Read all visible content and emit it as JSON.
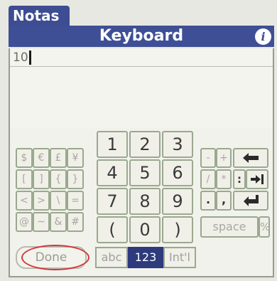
{
  "app": {
    "tab_label": "Notas",
    "title": "Keyboard",
    "info_icon": "i"
  },
  "editor": {
    "value": "10"
  },
  "keyboard": {
    "symbols": [
      [
        "$",
        "€",
        "£",
        "¥"
      ],
      [
        "[",
        "]",
        "{",
        "}"
      ],
      [
        "<",
        ">",
        "\\",
        "="
      ],
      [
        "@",
        "~",
        "&",
        "#"
      ]
    ],
    "numbers": [
      [
        "1",
        "2",
        "3"
      ],
      [
        "4",
        "5",
        "6"
      ],
      [
        "7",
        "8",
        "9"
      ],
      [
        "(",
        "0",
        ")"
      ]
    ],
    "right_keys": {
      "minus": "-",
      "plus": "+",
      "slash": "/",
      "asterisk": "*",
      "colon": ":",
      "period": ".",
      "comma": ",",
      "space": "space",
      "percent": "%",
      "backspace_icon": "backspace-arrow-icon",
      "tab_icon": "tab-arrow-icon",
      "enter_icon": "enter-arrow-icon"
    },
    "done": "Done",
    "modes": [
      {
        "label": "abc",
        "active": false
      },
      {
        "label": "123",
        "active": true
      },
      {
        "label": "Int'l",
        "active": false
      }
    ]
  },
  "colors": {
    "title_bar": "#3f4f96",
    "active_mode": "#2d3a7c",
    "highlight_ring": "#d23a3a"
  }
}
